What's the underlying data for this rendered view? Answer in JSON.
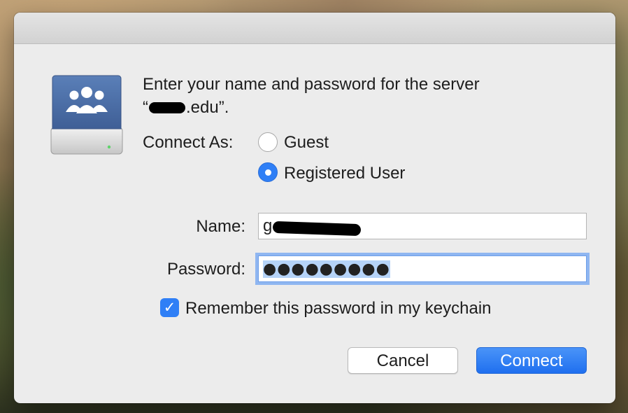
{
  "dialog": {
    "prompt_line1": "Enter your name and password for the server",
    "prompt_line2_open": "“",
    "prompt_line2_domain": ".edu”.",
    "connect_as_label": "Connect As:",
    "radio_guest": "Guest",
    "radio_registered": "Registered User",
    "selected_option": "Registered User",
    "name_label": "Name:",
    "name_value_visible": "g",
    "password_label": "Password:",
    "password_value": "●●●●●●●●●",
    "remember_label": "Remember this password in my keychain",
    "remember_checked": true,
    "cancel_label": "Cancel",
    "connect_label": "Connect"
  },
  "icons": {
    "server": "network-server-icon",
    "group": "users-group-icon",
    "checkmark": "checkmark-icon"
  },
  "colors": {
    "accent": "#2f7ff6",
    "focus_ring": "#8fb6f1",
    "selection": "#b5d3f8"
  }
}
